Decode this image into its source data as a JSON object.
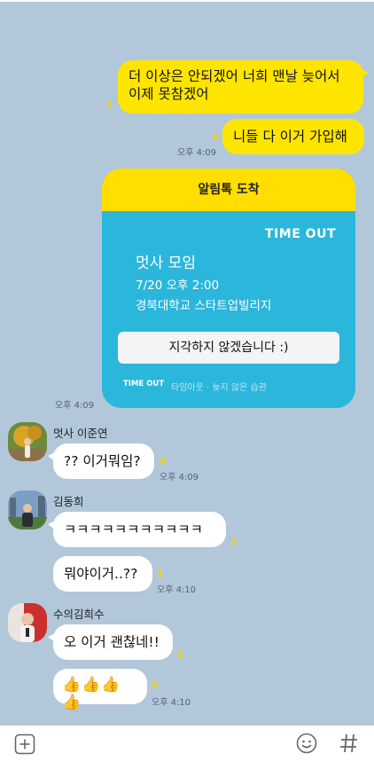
{
  "messages_out": [
    {
      "text": "더 이상은 안되겠어 너희 맨날 늦어서 이제 못참겠어",
      "unread": "2"
    },
    {
      "text": "니들 다 이거 가입해",
      "unread": "2",
      "time": "오후 4:09"
    }
  ],
  "card": {
    "header": "알림톡 도착",
    "brand": "TIME OUT",
    "event_title": "멋사 모임",
    "event_datetime": "7/20 오후 2:00",
    "event_place": "경북대학교 스타트업빌리지",
    "cta": "지각하지 않겠습니다 :)",
    "footer_brand": "TIME OUT",
    "footer_tagline": "타임아웃 · 늦지 않은 습관",
    "time": "오후 4:09"
  },
  "chat": [
    {
      "sender": "멋사 이준연",
      "messages": [
        {
          "text": "?? 이거뭐임?",
          "unread": "2",
          "time": "오후 4:09"
        }
      ]
    },
    {
      "sender": "김동희",
      "messages": [
        {
          "text": "ㅋㅋㅋㅋㅋㅋㅋㅋㅋㅋㅋ",
          "unread": "3"
        },
        {
          "text": "뭐야이거..??",
          "unread": "3",
          "time": "오후 4:10"
        }
      ]
    },
    {
      "sender": "수의김희수",
      "messages": [
        {
          "text": "오 이거 괜찮네!!",
          "unread": "5"
        },
        {
          "text": "👍👍👍👍",
          "unread": "5",
          "time": "오후 4:10"
        }
      ]
    }
  ],
  "input_bar": {
    "plus_icon": "plus-square-icon",
    "emoji_icon": "emoji-icon",
    "hash_icon": "hash-icon"
  },
  "colors": {
    "background": "#b2c7da",
    "my_bubble": "#fee500",
    "card_header": "#ffde00",
    "card_body": "#2bb6dc"
  }
}
